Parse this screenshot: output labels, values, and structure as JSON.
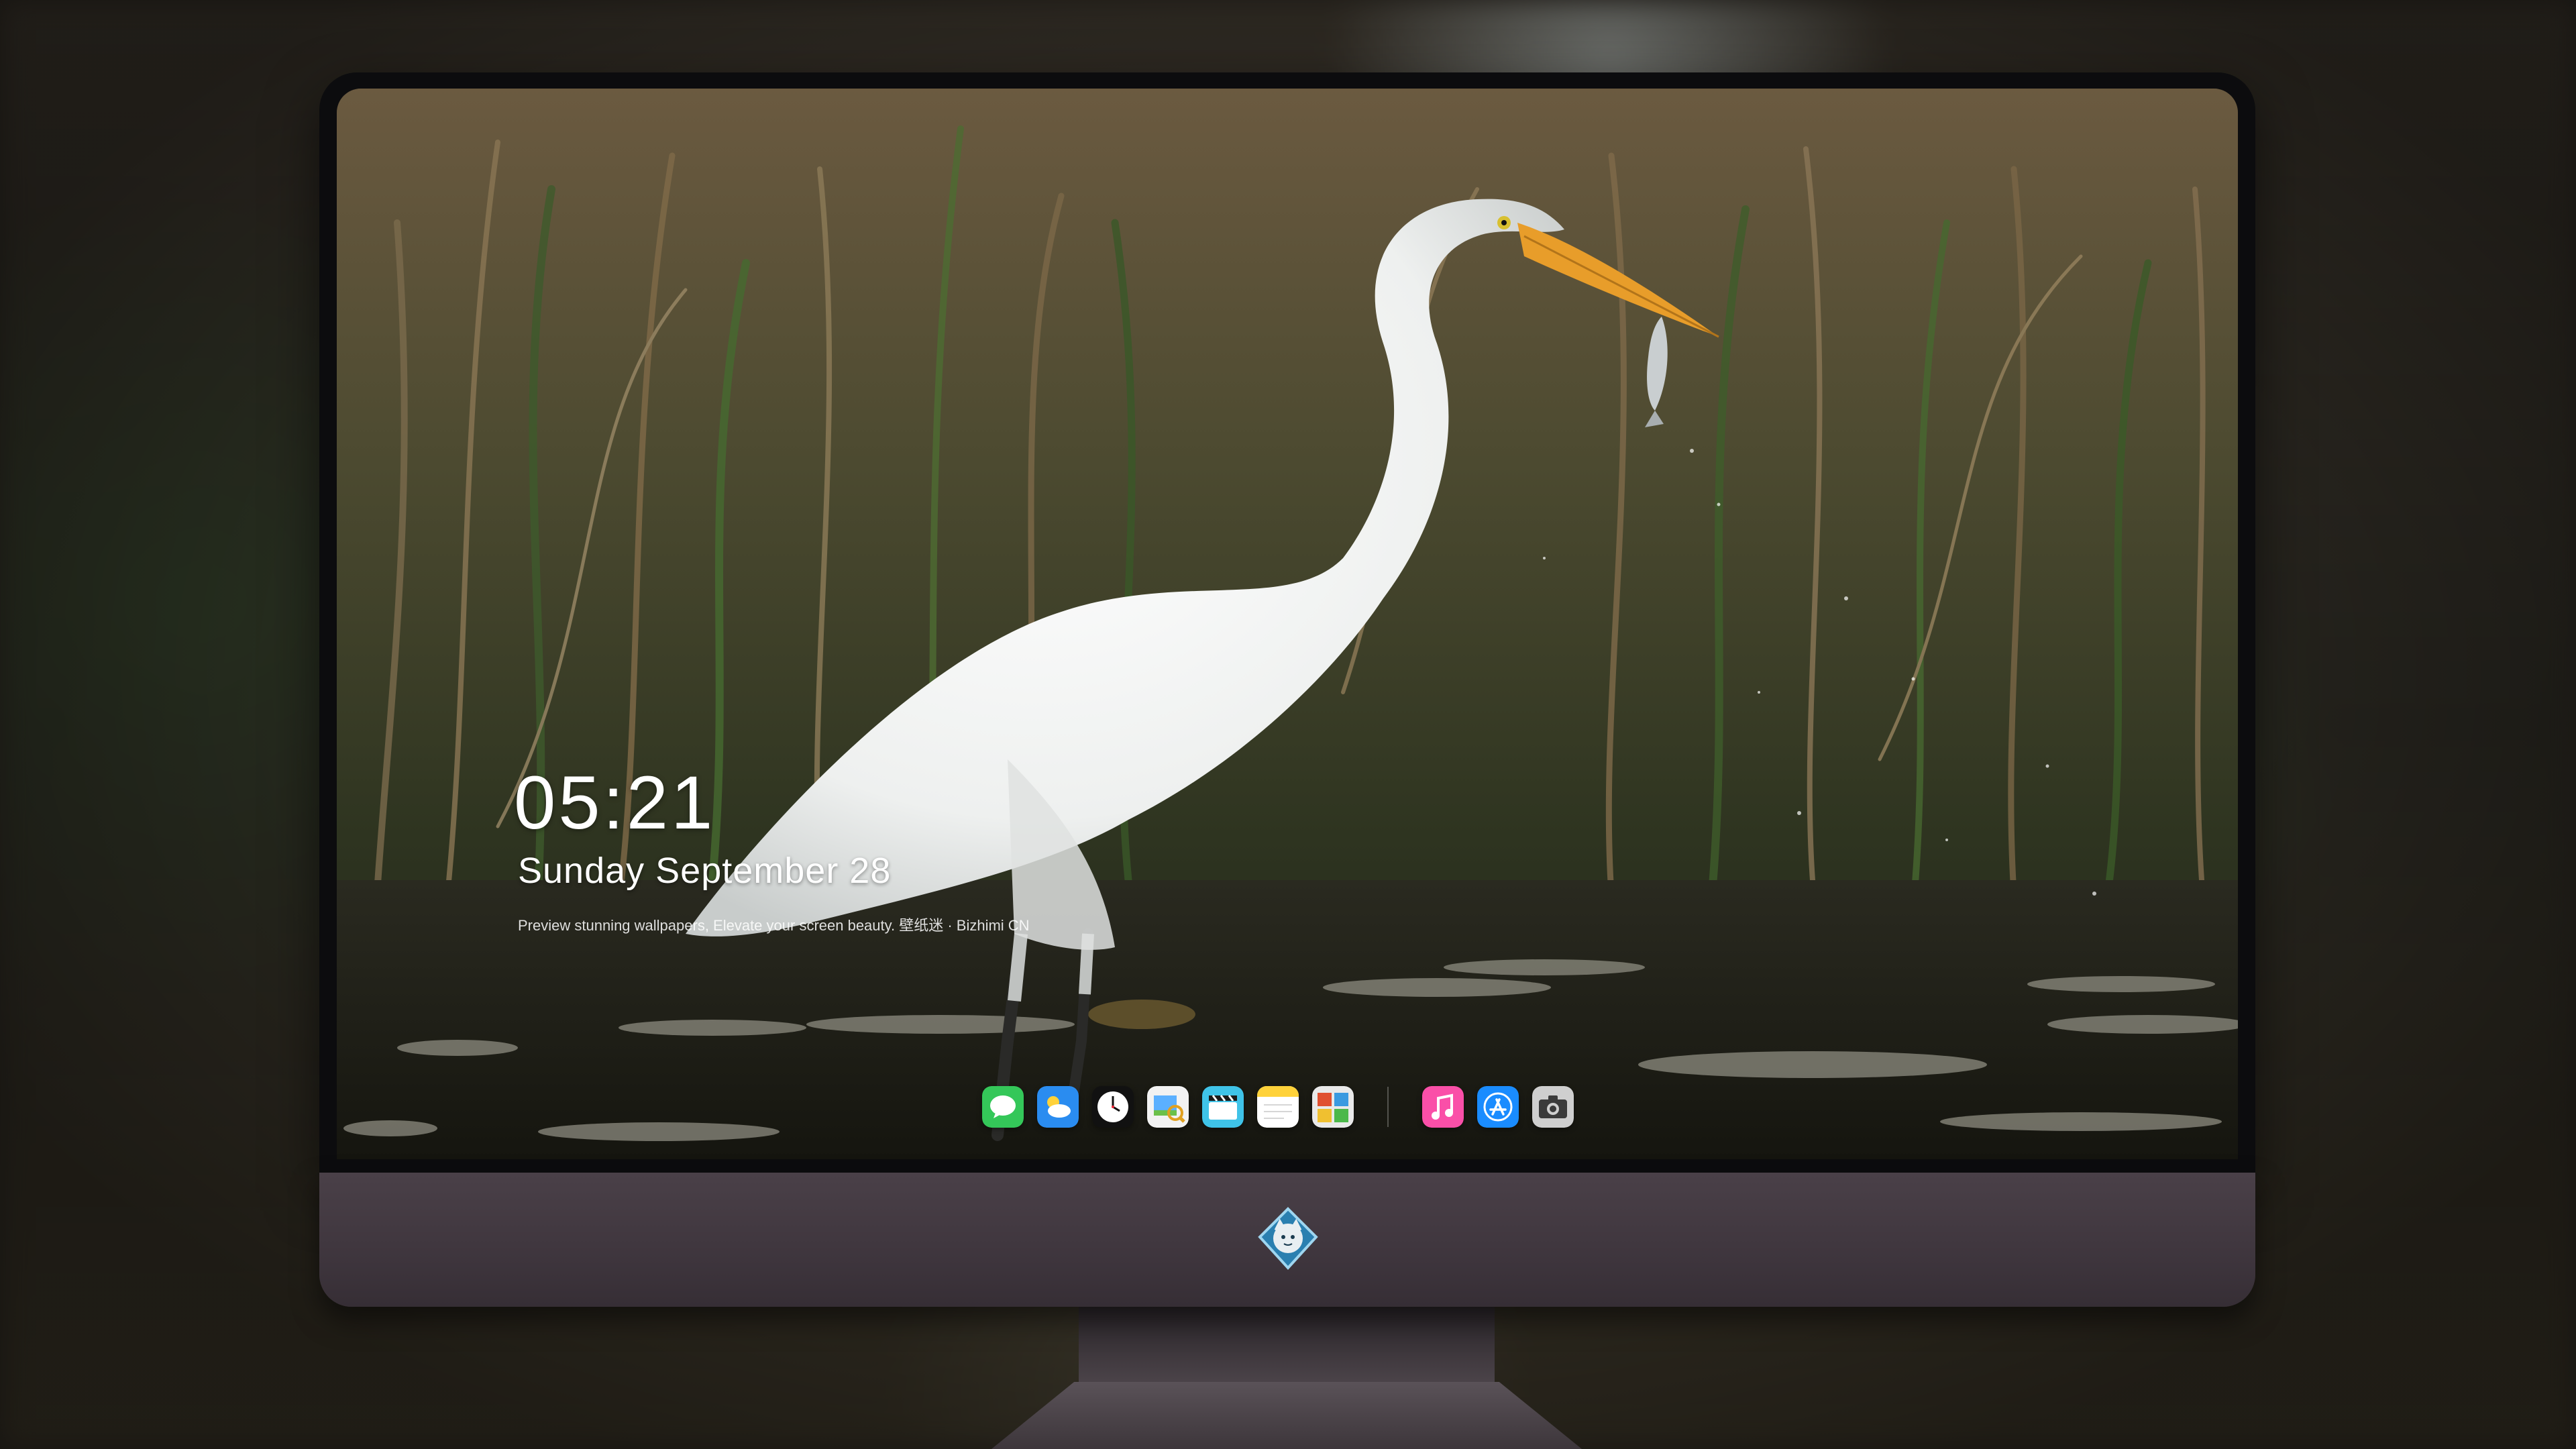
{
  "lockscreen": {
    "time": "05:21",
    "date": "Sunday September  28",
    "caption": "Preview stunning wallpapers, Elevate your screen beauty. 壁纸迷 · Bizhimi CN"
  },
  "dock": {
    "apps": [
      {
        "icon": "messages-icon"
      },
      {
        "icon": "weather-icon"
      },
      {
        "icon": "clock-icon"
      },
      {
        "icon": "preview-icon"
      },
      {
        "icon": "clips-icon"
      },
      {
        "icon": "notes-icon"
      },
      {
        "icon": "photo-booth-icon"
      },
      {
        "icon": "music-icon"
      },
      {
        "icon": "app-store-icon"
      },
      {
        "icon": "camera-icon"
      }
    ]
  },
  "colors": {
    "bezel": "#0c0c0e",
    "chin": "#3f363e",
    "dock_messages": "#34c759",
    "dock_music": "#fa4fa8",
    "dock_appstore": "#1a8cff"
  }
}
